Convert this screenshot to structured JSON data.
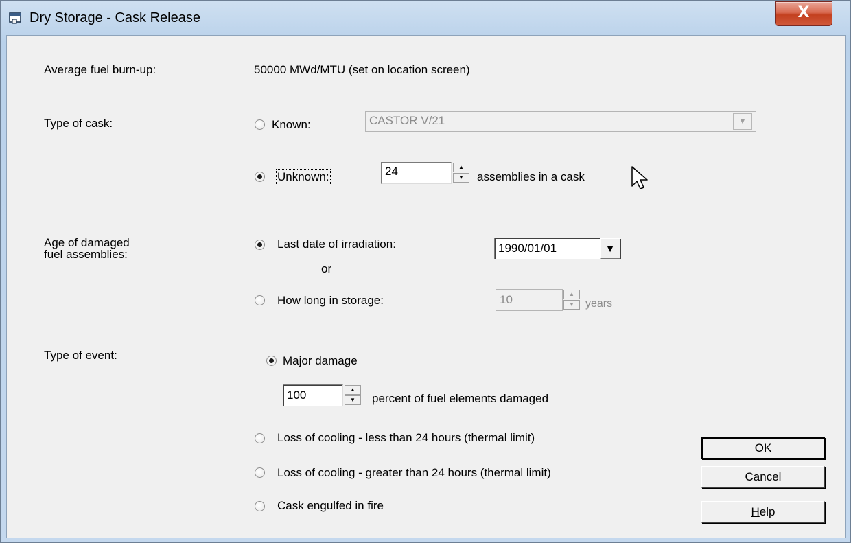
{
  "window": {
    "title": "Dry Storage - Cask Release",
    "close_glyph": "X",
    "icon": "window-icon"
  },
  "burnup": {
    "label": "Average fuel burn-up:",
    "value": "50000 MWd/MTU  (set on location screen)"
  },
  "cask": {
    "label": "Type of cask:",
    "known_label": "Known:",
    "known_selected": false,
    "known_value": "CASTOR V/21",
    "unknown_label": "Unknown:",
    "unknown_selected": true,
    "assemblies_value": "24",
    "assemblies_suffix": "assemblies in a cask"
  },
  "age": {
    "label_line1": "Age of damaged",
    "label_line2": "fuel assemblies:",
    "last_date_label": "Last date of irradiation:",
    "last_date_selected": true,
    "last_date_value": "1990/01/01",
    "or_label": "or",
    "storage_label": "How long in storage:",
    "storage_selected": false,
    "storage_value": "10",
    "storage_suffix": "years"
  },
  "event": {
    "label": "Type of event:",
    "major_label": "Major damage",
    "major_selected": true,
    "percent_value": "100",
    "percent_suffix": "percent of fuel elements damaged",
    "loss_lt_label": "Loss of cooling - less than 24 hours  (thermal limit)",
    "loss_gt_label": "Loss of cooling - greater than 24 hours  (thermal limit)",
    "fire_label": "Cask engulfed in fire"
  },
  "buttons": {
    "ok": "OK",
    "cancel": "Cancel",
    "help_mnemonic": "H",
    "help_rest": "elp"
  },
  "colors": {
    "title_gradient": "#b9d1ea",
    "close_red": "#c3401f",
    "client_bg": "#f0f0f0",
    "disabled_text": "#8c8c8c"
  }
}
